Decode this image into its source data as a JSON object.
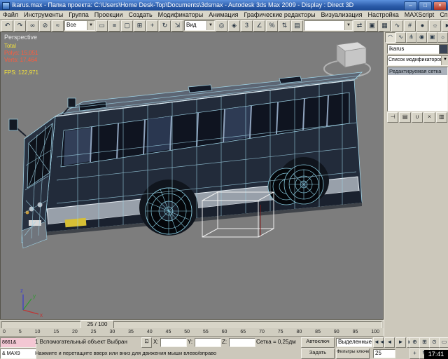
{
  "window": {
    "title": "ikarus.max - Папка проекта: C:\\Users\\Home Desk-Top\\Documents\\3dsmax  - Autodesk 3ds Max 2009  - Display : Direct 3D",
    "minimize": "–",
    "maximize": "□",
    "close": "×"
  },
  "menu": {
    "items": [
      "Файл",
      "Инструменты",
      "Группа",
      "Проекции",
      "Создать",
      "Модификаторы",
      "Анимация",
      "Графические редакторы",
      "Визуализация",
      "Настройка",
      "MAXScript",
      "Справка"
    ]
  },
  "toolbar": {
    "icons_left": [
      {
        "g": "↶",
        "n": "undo"
      },
      {
        "g": "↷",
        "n": "redo"
      },
      {
        "g": "∞",
        "n": "select-and-link"
      },
      {
        "g": "⊘",
        "n": "unlink-selection"
      },
      {
        "g": "≈",
        "n": "bind-to-space-warp"
      }
    ],
    "selection_filter": "Все",
    "icons_mid": [
      {
        "g": "▭",
        "n": "select-object"
      },
      {
        "g": "≡",
        "n": "select-by-name"
      },
      {
        "g": "▢",
        "n": "rectangular-selection-region"
      },
      {
        "g": "⊞",
        "n": "window-crossing"
      },
      {
        "g": "+",
        "n": "select-and-move"
      },
      {
        "g": "↻",
        "n": "select-and-rotate"
      },
      {
        "g": "⇲",
        "n": "select-and-scale"
      }
    ],
    "coord_system": "Вид",
    "icons_mid2": [
      {
        "g": "◎",
        "n": "use-pivot-point-center"
      },
      {
        "g": "◈",
        "n": "select-and-manipulate"
      },
      {
        "g": "3",
        "n": "snaps-toggle"
      },
      {
        "g": "∠",
        "n": "angle-snap"
      },
      {
        "g": "%",
        "n": "percent-snap"
      },
      {
        "g": "⇅",
        "n": "spinner-snap"
      },
      {
        "g": "▤",
        "n": "edit-named-selection-sets"
      }
    ],
    "selection_set_value": "",
    "icons_right": [
      {
        "g": "⇄",
        "n": "mirror"
      },
      {
        "g": "▣",
        "n": "align"
      },
      {
        "g": "▦",
        "n": "layer-manager"
      },
      {
        "g": "∿",
        "n": "curve-editor"
      },
      {
        "g": "#",
        "n": "schematic-view"
      },
      {
        "g": "●",
        "n": "material-editor"
      },
      {
        "g": "☼",
        "n": "render-setup"
      },
      {
        "g": "►",
        "n": "quick-render"
      }
    ]
  },
  "viewport": {
    "label": "Perspective",
    "stats": {
      "total": "Total",
      "polys": "Polys: 15,051",
      "verts": "Verts: 17,464",
      "fps": "FPS: 122,971"
    }
  },
  "command_panel": {
    "tabs": [
      {
        "g": "◠",
        "n": "create"
      },
      {
        "g": "∿",
        "n": "modify"
      },
      {
        "g": "⋔",
        "n": "hierarchy"
      },
      {
        "g": "◉",
        "n": "motion"
      },
      {
        "g": "▣",
        "n": "display"
      },
      {
        "g": "☼",
        "n": "utilities"
      }
    ],
    "object_name": "ikarus",
    "modifier_list": "Список модификаторов",
    "stack": [
      "Редактируемая сетка"
    ],
    "stack_tools": [
      "⊣",
      "▤",
      "∪",
      "×",
      "▥"
    ]
  },
  "timeline": {
    "slider": "25 / 100"
  },
  "trackbar": {
    "ticks": [
      "0",
      "5",
      "10",
      "15",
      "20",
      "25",
      "30",
      "35",
      "40",
      "45",
      "50",
      "55",
      "60",
      "65",
      "70",
      "75",
      "80",
      "85",
      "90",
      "95",
      "100"
    ]
  },
  "status": {
    "listener_top": "8661&",
    "listener_bottom": "& MAX9",
    "selection": "1 Вспомогательный объект Выбран",
    "prompt": "Нажмите и перетащите вверх или вниз для движения мыши влево/вправо",
    "lock": "⊡",
    "x": "X:",
    "y": "Y:",
    "z": "Z:",
    "x_value": "",
    "y_value": "",
    "z_value": "",
    "grid": "Сетка = 0,25дм",
    "auto_key": "Автоключ",
    "set_key": "Задать",
    "selected_dd": "Выделенные",
    "key_filters": "Фильтры ключей...",
    "frame": "25",
    "playback": [
      "◄◄",
      "◄",
      "►",
      "►►"
    ],
    "nav": [
      "⊕",
      "⊞",
      "⊙",
      "▭",
      "+",
      "↻",
      "⇲",
      "▣"
    ]
  },
  "clock": "17:41",
  "colors": {
    "stats_label": "#f2e13c",
    "stats_value": "#ff5a3c",
    "wireframe": "#9fd3e6",
    "bus_body": "#232b3a",
    "viewport_bg": "#7d7d7d"
  }
}
